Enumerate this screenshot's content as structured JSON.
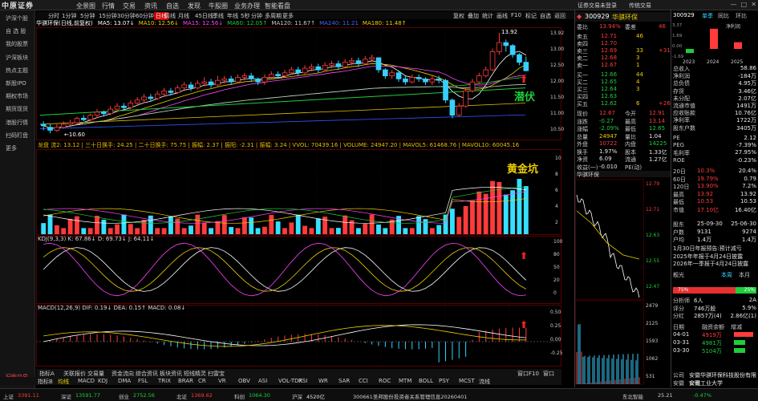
{
  "logo": "中原证券",
  "top_menu": [
    "全景图",
    "行情",
    "交易",
    "资讯",
    "自选",
    "发现",
    "牛股圈",
    "业务办理",
    "智能看盘"
  ],
  "top_right": [
    "证券交易未登录",
    "传统交易"
  ],
  "sidebar": [
    "沪深个股",
    "自 选 股",
    "我的股票",
    "沪深板块",
    "热点主题",
    "新股IPO",
    "期权市场",
    "期货现货",
    "港股行情",
    "扫码盯盘",
    "更多"
  ],
  "sidebar_bottom": "旧版交易",
  "toolbar": [
    "分时",
    "1分钟",
    "5分钟",
    "15分钟",
    "30分钟",
    "60分钟",
    "日线",
    "周线",
    "月线",
    "45日线",
    "季线",
    "年线",
    "5秒",
    "分钟",
    "多周期",
    "更多"
  ],
  "toolbar_right": [
    "复权",
    "叠加",
    "统计",
    "画线",
    "F10",
    "标记",
    "自选",
    "返回"
  ],
  "title_row": {
    "name": "华骐环保(日线,前复权)",
    "ma": [
      {
        "label": "MA5: 13.07↓",
        "color": "#ffffff"
      },
      {
        "label": "MA10: 12.56↓",
        "color": "#f0d000"
      },
      {
        "label": "MA15: 12.56↓",
        "color": "#ff44ff"
      },
      {
        "label": "MA60: 12.05↑",
        "color": "#1ecf3a"
      },
      {
        "label": "MA120: 11.67↑",
        "color": "#c8c8c8"
      },
      {
        "label": "MA240: 11.21",
        "color": "#4466ff"
      },
      {
        "label": "MA180: 11.48↑",
        "color": "#f0d000"
      }
    ]
  },
  "price_labels": {
    "high": "13.92",
    "low": "←10.60"
  },
  "annotations": {
    "qianfu": "潜伏",
    "huangjinkeng": "黄金坑"
  },
  "vol_title": "龙盘 流2: 13.12 | 三十日换手: 24.25 | 二十日换手: 75.75 | 振幅: 2.37 | 振阳: -2.31 | 振幅: 3.24 | VVOL: 70439.16 | VOLUME: 24947.20 | MAVOL5: 61468.76 | MAVOL10: 60045.16 | MAVOL15: 50963.58",
  "kdj_title": "KDJ(9,3,3)  K: 67.86↓  D: 69.73↓  J: 64.11↓",
  "macd_title": "MACD(12,26,9)  DIF: 0.19↓  DEA: 0.15↑  MACD: 0.08↓",
  "axis_main": [
    "13.92",
    "13.00",
    "12.50",
    "12.00",
    "11.50",
    "11.00",
    "10.50"
  ],
  "axis_vol": [
    "10",
    "8",
    "6",
    "4",
    "2"
  ],
  "axis_kdj": [
    "100",
    "80",
    "50",
    "20",
    "0"
  ],
  "axis_macd": [
    "0.50",
    "0.25",
    "0.00",
    "-0.25"
  ],
  "indbar": [
    "指标A",
    "关联报价",
    "交易量",
    "资金流向",
    "综合资讯",
    "板块资讯",
    "短线精灵",
    "扫雷宝"
  ],
  "indbar_right": [
    "窗口F10",
    "窗口"
  ],
  "indbar2": [
    "指标B",
    "均线",
    "MACD",
    "KDJ",
    "DMA",
    "FSL",
    "TRIX",
    "BRAR",
    "CR",
    "VR",
    "OBV",
    "ASI",
    "VOL-TDX",
    "RSI",
    "WR",
    "SAR",
    "CCI",
    "ROC",
    "MTM",
    "BOLL",
    "PSY",
    "MCST",
    "流线"
  ],
  "stock": {
    "code": "300929",
    "name": "华骐环保",
    "change_pct": "13.94%",
    "weibi_label": "委比",
    "weicha_label": "委差",
    "weicha_value": "46"
  },
  "asks": [
    {
      "label": "卖五",
      "price": "12.71",
      "vol": "46",
      "chg": ""
    },
    {
      "label": "卖四",
      "price": "12.70",
      "vol": "",
      "chg": ""
    },
    {
      "label": "卖三",
      "price": "12.69",
      "vol": "33",
      "chg": "+31"
    },
    {
      "label": "卖二",
      "price": "12.68",
      "vol": "3",
      "chg": ""
    },
    {
      "label": "卖一",
      "price": "12.67",
      "vol": "1",
      "chg": ""
    }
  ],
  "bids": [
    {
      "label": "买一",
      "price": "12.66",
      "vol": "44",
      "chg": ""
    },
    {
      "label": "买二",
      "price": "12.65",
      "vol": "4",
      "chg": ""
    },
    {
      "label": "买三",
      "price": "12.64",
      "vol": "3",
      "chg": ""
    },
    {
      "label": "买四",
      "price": "12.63",
      "vol": "",
      "chg": ""
    },
    {
      "label": "买五",
      "price": "12.62",
      "vol": "6",
      "chg": "+26"
    }
  ],
  "quote_stats": [
    {
      "l1": "现价",
      "v1": "12.67",
      "l2": "今开",
      "v2": "12.91",
      "c1": "red",
      "c2": "red"
    },
    {
      "l1": "涨跌",
      "v1": "-0.27",
      "l2": "最高",
      "v2": "13.14",
      "c1": "green",
      "c2": "red"
    },
    {
      "l1": "涨幅",
      "v1": "-2.09%",
      "l2": "最低",
      "v2": "12.65",
      "c1": "green",
      "c2": "green"
    },
    {
      "l1": "总量",
      "v1": "24947",
      "l2": "量比",
      "v2": "1.04",
      "c1": "yellow",
      "c2": "white"
    },
    {
      "l1": "外盘",
      "v1": "10722",
      "l2": "内盘",
      "v2": "14225",
      "c1": "red",
      "c2": "green"
    },
    {
      "l1": "换手",
      "v1": "1.97%",
      "l2": "股本",
      "v2": "1.33亿",
      "c1": "white",
      "c2": "white"
    },
    {
      "l1": "净资",
      "v1": "6.09",
      "l2": "流通",
      "v2": "1.27亿",
      "c1": "white",
      "c2": "white"
    },
    {
      "l1": "收益(一)",
      "v1": "-0.010",
      "l2": "PE(动)",
      "v2": "",
      "c1": "white",
      "c2": "white"
    }
  ],
  "mini_chart_title": "华骐环保",
  "mini_axis": [
    "12.79",
    "12.71",
    "12.63",
    "12.55",
    "12.47",
    "2479",
    "2125",
    "1593",
    "1062",
    "531"
  ],
  "fin": {
    "code": "300929",
    "tabs": [
      "单季",
      "同比",
      "环比"
    ],
    "bar_years": [
      "2023",
      "2024",
      "2025"
    ],
    "bar_label": "净利润",
    "bar_values": [
      -0.184,
      0.9,
      0.3
    ],
    "scale": [
      "3.37",
      "1.69",
      "0.00",
      "-1.69"
    ],
    "rows": [
      {
        "label": "总收入",
        "value": "58.86"
      },
      {
        "label": "净利润",
        "value": "-184万"
      },
      {
        "label": "总负债",
        "value": "4.95万"
      },
      {
        "label": "存货",
        "value": "3.46亿"
      },
      {
        "label": "未分配",
        "value": "2.07亿"
      },
      {
        "label": "流通市值",
        "value": "1491万"
      },
      {
        "label": "应收账款",
        "value": "10.76亿"
      },
      {
        "label": "净利率",
        "value": "1722万"
      },
      {
        "label": "股东户数",
        "value": "3405万"
      }
    ],
    "rows2": [
      {
        "label": "PE",
        "value": "2.12"
      },
      {
        "label": "PEG",
        "value": "-7.39%"
      },
      {
        "label": "毛利率",
        "value": "27.95%"
      },
      {
        "label": "ROE",
        "value": "-0.23%"
      }
    ],
    "rows3": [
      {
        "label": "20日",
        "v1": "10.3%",
        "v2": "20.4%"
      },
      {
        "label": "60日",
        "v1": "19.79%",
        "v2": "0.79"
      },
      {
        "label": "120日",
        "v1": "13.90%",
        "v2": "7.2%"
      },
      {
        "label": "最高",
        "v1": "13.92",
        "v2": "13.92"
      },
      {
        "label": "最低",
        "v1": "10.53",
        "v2": "10.53"
      },
      {
        "label": "市值",
        "v1": "17.10亿",
        "v2": "16.40亿"
      }
    ],
    "rows4": [
      {
        "label": "股东",
        "v1": "25-09-30",
        "v2": "25-06-30"
      },
      {
        "label": "户数",
        "v1": "9131",
        "v2": "9274"
      },
      {
        "label": "户均",
        "v1": "1.4万",
        "v2": "1.4万"
      }
    ],
    "notice": [
      "1月30日年报预告:预计减亏",
      "2025年年报于4月24日披露",
      "2026年一季报于4月24日披露"
    ],
    "rating_label": "舰光",
    "rating_tabs": [
      "本周",
      "本月"
    ],
    "rating_red": "75%",
    "rating_green": "25%",
    "analyst": [
      {
        "l": "分析师",
        "v1": "6人",
        "v2": "2A"
      },
      {
        "l": "评分",
        "v1": "746万股",
        "v2": "5.9%"
      },
      {
        "l": "分红",
        "v1": "2857万(4)",
        "v2": "2.86亿(1)"
      }
    ],
    "flow_title": [
      "日期",
      "融资余额",
      "增减"
    ],
    "flow_rows": [
      {
        "d": "04-01",
        "v": "4919万",
        "c": "red"
      },
      {
        "d": "03-31",
        "v": "4981万",
        "c": "green"
      },
      {
        "d": "03-30",
        "v": "5104万",
        "c": "green"
      }
    ],
    "company": [
      "公司",
      "安徽华骐环保科技股份有限公司"
    ],
    "industry": [
      "安徽",
      "安徽工业大学"
    ]
  },
  "statusbar": [
    {
      "t": "上证",
      "v": "3391.11",
      "c": "red"
    },
    {
      "t": "深证",
      "v": "13591.77",
      "c": "green"
    },
    {
      "t": "创业",
      "v": "2752.56",
      "c": "green"
    },
    {
      "t": "北证",
      "v": "1369.62",
      "c": "red"
    },
    {
      "t": "科创",
      "v": "1064.30",
      "c": "green"
    },
    {
      "t": "沪深",
      "v": "4520亿",
      "c": "white"
    }
  ],
  "status_news": "300661圣邦股份投资者关系管理信息20260401",
  "status_right": [
    "东北智能",
    "25.21",
    "-0.47%"
  ],
  "chart_data": {
    "type": "candlestick",
    "title": "华骐环保(日线,前复权)",
    "candles": [
      [
        10.9,
        10.85,
        11.0,
        10.7
      ],
      [
        10.8,
        10.7,
        10.9,
        10.6
      ],
      [
        10.7,
        10.8,
        10.9,
        10.65
      ],
      [
        10.8,
        10.9,
        11.0,
        10.75
      ],
      [
        10.9,
        10.95,
        11.05,
        10.85
      ],
      [
        10.95,
        11.1,
        11.15,
        10.9
      ],
      [
        11.1,
        11.05,
        11.2,
        11.0
      ],
      [
        11.05,
        11.2,
        11.25,
        11.0
      ],
      [
        11.2,
        11.3,
        11.4,
        11.1
      ],
      [
        11.3,
        11.25,
        11.35,
        11.15
      ],
      [
        11.25,
        11.4,
        11.5,
        11.2
      ],
      [
        11.4,
        11.5,
        11.6,
        11.3
      ],
      [
        11.5,
        11.45,
        11.6,
        11.35
      ],
      [
        11.45,
        11.6,
        11.7,
        11.4
      ],
      [
        11.6,
        11.7,
        11.8,
        11.5
      ],
      [
        11.7,
        11.8,
        11.9,
        11.6
      ],
      [
        11.8,
        11.75,
        11.9,
        11.65
      ],
      [
        11.75,
        11.9,
        12.0,
        11.7
      ],
      [
        11.9,
        12.0,
        12.1,
        11.8
      ],
      [
        12.0,
        11.95,
        12.1,
        11.85
      ],
      [
        11.95,
        12.1,
        12.2,
        11.9
      ],
      [
        12.1,
        12.2,
        12.3,
        12.0
      ],
      [
        12.2,
        12.1,
        12.3,
        12.0
      ],
      [
        12.1,
        12.25,
        12.35,
        12.05
      ],
      [
        12.25,
        12.3,
        12.45,
        12.15
      ],
      [
        12.3,
        12.2,
        12.4,
        12.1
      ],
      [
        12.2,
        12.35,
        12.5,
        12.15
      ],
      [
        12.35,
        12.4,
        12.5,
        12.25
      ],
      [
        12.4,
        12.3,
        12.5,
        12.2
      ],
      [
        12.3,
        12.45,
        12.55,
        12.25
      ],
      [
        12.45,
        12.5,
        12.6,
        12.35
      ],
      [
        12.5,
        12.4,
        12.6,
        12.3
      ],
      [
        12.4,
        12.3,
        12.45,
        12.2
      ],
      [
        12.3,
        12.45,
        12.55,
        12.2
      ],
      [
        12.45,
        12.55,
        12.65,
        12.4
      ],
      [
        12.55,
        12.5,
        12.65,
        12.4
      ],
      [
        12.5,
        12.6,
        12.7,
        12.45
      ],
      [
        12.6,
        12.7,
        12.8,
        12.55
      ],
      [
        12.7,
        12.6,
        12.8,
        12.5
      ],
      [
        12.6,
        12.75,
        12.85,
        12.55
      ],
      [
        12.75,
        12.8,
        12.9,
        12.65
      ],
      [
        12.8,
        12.7,
        12.9,
        12.6
      ],
      [
        12.7,
        12.85,
        12.95,
        12.65
      ],
      [
        12.85,
        12.9,
        13.0,
        12.75
      ],
      [
        12.9,
        12.8,
        13.0,
        12.7
      ],
      [
        12.8,
        12.95,
        13.05,
        12.75
      ],
      [
        12.95,
        13.0,
        13.1,
        12.85
      ],
      [
        13.0,
        12.9,
        13.1,
        12.8
      ],
      [
        12.9,
        13.05,
        13.15,
        12.85
      ],
      [
        13.05,
        13.1,
        13.2,
        12.95
      ],
      [
        13.1,
        12.7,
        13.1,
        12.6
      ],
      [
        12.7,
        12.5,
        12.75,
        12.4
      ],
      [
        12.5,
        12.6,
        12.7,
        12.4
      ],
      [
        12.6,
        12.4,
        12.65,
        12.3
      ],
      [
        12.4,
        12.3,
        12.5,
        12.2
      ],
      [
        12.3,
        12.45,
        12.55,
        12.25
      ],
      [
        12.45,
        12.4,
        12.55,
        12.3
      ],
      [
        12.4,
        12.3,
        12.45,
        12.2
      ],
      [
        12.3,
        12.4,
        12.5,
        12.2
      ],
      [
        12.4,
        12.35,
        12.5,
        12.25
      ],
      [
        12.35,
        11.7,
        12.4,
        11.6
      ],
      [
        11.7,
        11.2,
        11.75,
        11.1
      ],
      [
        11.2,
        11.5,
        11.6,
        11.15
      ],
      [
        11.5,
        12.0,
        12.1,
        11.45
      ],
      [
        12.0,
        12.3,
        12.4,
        11.95
      ],
      [
        12.3,
        12.5,
        12.6,
        12.25
      ],
      [
        12.5,
        12.7,
        12.8,
        12.45
      ],
      [
        12.7,
        13.3,
        13.4,
        12.65
      ],
      [
        13.3,
        13.6,
        13.92,
        13.2
      ],
      [
        13.6,
        13.5,
        13.7,
        13.3
      ],
      [
        13.5,
        13.2,
        13.55,
        13.1
      ],
      [
        13.2,
        12.95,
        13.25,
        12.85
      ],
      [
        12.95,
        12.67,
        13.14,
        12.65
      ]
    ],
    "ylim": [
      10.5,
      14.0
    ]
  }
}
